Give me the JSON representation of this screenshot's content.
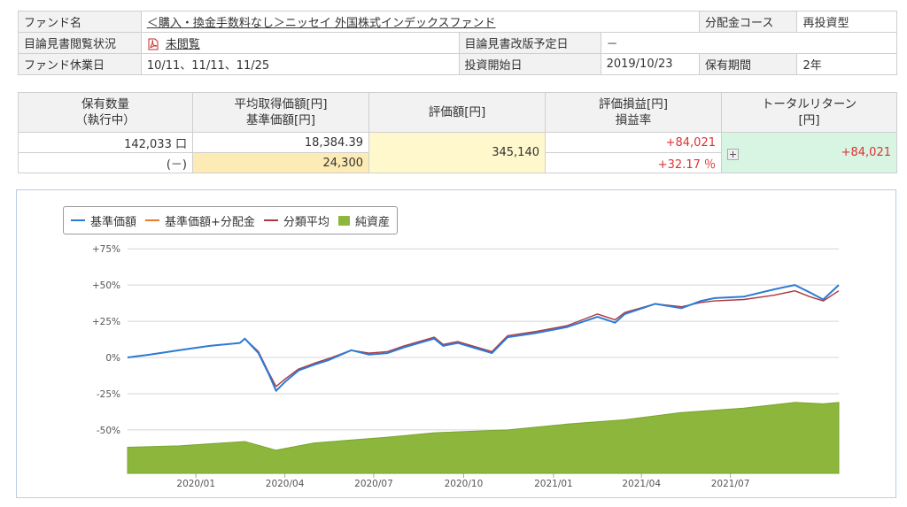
{
  "fund": {
    "name_label": "ファンド名",
    "name": "＜購入・換金手数料なし＞ニッセイ 外国株式インデックスファンド",
    "course_label": "分配金コース",
    "course_value": "再投資型",
    "prospectus_label": "目論見書閲覧状況",
    "prospectus_value": "未閲覧",
    "revision_label": "目論見書改版予定日",
    "revision_value": "－",
    "holiday_label": "ファンド休業日",
    "holiday_value": "10/11、11/11、11/25",
    "start_label": "投資開始日",
    "start_value": "2019/10/23",
    "period_label": "保有期間",
    "period_value": "2年"
  },
  "holdings": {
    "headers": {
      "qty_1": "保有数量",
      "qty_2": "（執行中）",
      "avg_1": "平均取得価額[円]",
      "avg_2": "基準価額[円]",
      "value": "評価額[円]",
      "pl_1": "評価損益[円]",
      "pl_2": "損益率",
      "total_1": "トータルリターン",
      "total_2": "[円]"
    },
    "qty": "142,033 口",
    "qty_pending": "(－)",
    "avg_cost": "18,384.39",
    "nav": "24,300",
    "value": "345,140",
    "pl": "+84,021",
    "pl_rate": "+32.17 ％",
    "total_return": "+84,021"
  },
  "chart_data": {
    "type": "line",
    "legend": [
      {
        "name": "基準価額",
        "color": "#2d7ad6"
      },
      {
        "name": "基準価額+分配金",
        "color": "#ec7b2c"
      },
      {
        "name": "分類平均",
        "color": "#b0373a"
      },
      {
        "name": "純資産",
        "color": "#8cb63c"
      }
    ],
    "y_ticks": [
      "+75%",
      "+50%",
      "+25%",
      "0%",
      "-25%",
      "-50%"
    ],
    "x_ticks": [
      "2020/01",
      "2020/04",
      "2020/07",
      "2020/10",
      "2021/01",
      "2021/04",
      "2021/07"
    ],
    "ylim": [
      -80,
      80
    ],
    "xlim": [
      "2019-10-23",
      "2021-10-20"
    ],
    "series": [
      {
        "name": "基準価額",
        "x": [
          "2019-10-23",
          "2019-11-15",
          "2019-12-15",
          "2020-01-15",
          "2020-02-15",
          "2020-02-20",
          "2020-03-05",
          "2020-03-16",
          "2020-03-23",
          "2020-04-01",
          "2020-04-15",
          "2020-05-01",
          "2020-05-15",
          "2020-06-08",
          "2020-06-26",
          "2020-07-15",
          "2020-08-01",
          "2020-09-01",
          "2020-09-10",
          "2020-09-25",
          "2020-10-10",
          "2020-10-30",
          "2020-11-15",
          "2020-12-15",
          "2021-01-15",
          "2021-02-15",
          "2021-03-05",
          "2021-03-15",
          "2021-04-15",
          "2021-05-12",
          "2021-06-01",
          "2021-06-15",
          "2021-07-15",
          "2021-08-15",
          "2021-09-05",
          "2021-09-20",
          "2021-10-04",
          "2021-10-20"
        ],
        "values": [
          0,
          2,
          5,
          8,
          10,
          13,
          3,
          -12,
          -23,
          -17,
          -9,
          -5,
          -2,
          5,
          2,
          3,
          7,
          13,
          8,
          10,
          7,
          3,
          14,
          17,
          21,
          28,
          24,
          30,
          37,
          34,
          39,
          41,
          42,
          47,
          50,
          45,
          40,
          50
        ]
      },
      {
        "name": "分類平均",
        "x": [
          "2019-10-23",
          "2019-11-15",
          "2019-12-15",
          "2020-01-15",
          "2020-02-15",
          "2020-02-20",
          "2020-03-05",
          "2020-03-16",
          "2020-03-23",
          "2020-04-01",
          "2020-04-15",
          "2020-05-01",
          "2020-05-15",
          "2020-06-08",
          "2020-06-26",
          "2020-07-15",
          "2020-08-01",
          "2020-09-01",
          "2020-09-10",
          "2020-09-25",
          "2020-10-10",
          "2020-10-30",
          "2020-11-15",
          "2020-12-15",
          "2021-01-15",
          "2021-02-15",
          "2021-03-05",
          "2021-03-15",
          "2021-04-15",
          "2021-05-12",
          "2021-06-01",
          "2021-06-15",
          "2021-07-15",
          "2021-08-15",
          "2021-09-05",
          "2021-09-20",
          "2021-10-04",
          "2021-10-20"
        ],
        "values": [
          0,
          2,
          5,
          8,
          10,
          13,
          4,
          -11,
          -20,
          -15,
          -8,
          -4,
          -1,
          5,
          3,
          4,
          8,
          14,
          9,
          11,
          8,
          4,
          15,
          18,
          22,
          30,
          26,
          31,
          37,
          35,
          38,
          39,
          40,
          43,
          46,
          42,
          39,
          46
        ]
      },
      {
        "name": "純資産",
        "x": [
          "2019-10-23",
          "2019-12-15",
          "2020-02-20",
          "2020-03-23",
          "2020-05-01",
          "2020-07-15",
          "2020-09-01",
          "2020-11-15",
          "2021-01-15",
          "2021-03-15",
          "2021-05-12",
          "2021-07-15",
          "2021-09-05",
          "2021-10-04",
          "2021-10-20"
        ],
        "values": [
          -62,
          -61,
          -58,
          -64,
          -59,
          -55,
          -52,
          -50,
          -46,
          -43,
          -38,
          -35,
          -31,
          -32,
          -31
        ]
      }
    ]
  }
}
